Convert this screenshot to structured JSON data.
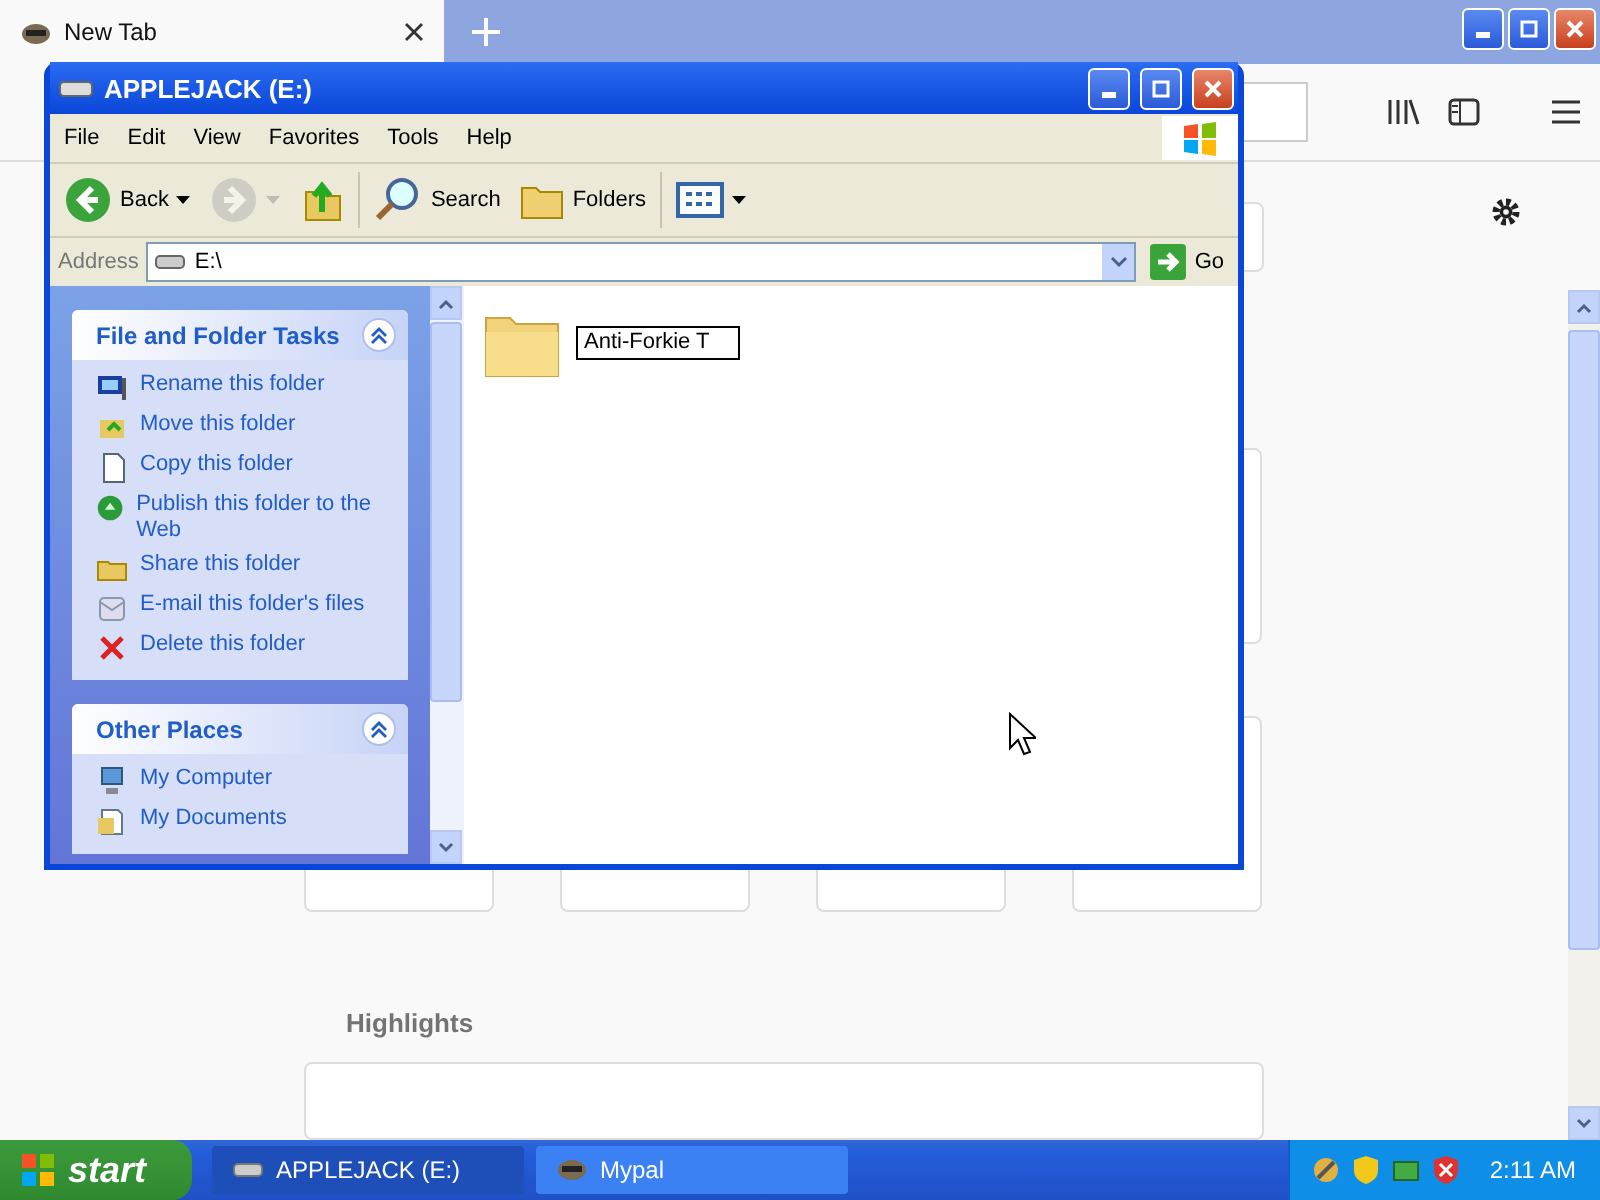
{
  "browser": {
    "tabs": [
      {
        "label": "New Tab",
        "selected": true
      }
    ],
    "section_title": "Highlights"
  },
  "explorer": {
    "title": "APPLEJACK (E:)",
    "menu": [
      "File",
      "Edit",
      "View",
      "Favorites",
      "Tools",
      "Help"
    ],
    "toolbar": {
      "back": "Back",
      "search": "Search",
      "folders": "Folders",
      "forward_disabled": true
    },
    "address": {
      "label": "Address",
      "value": "E:\\",
      "go": "Go"
    },
    "panels": [
      {
        "title": "File and Folder Tasks",
        "expanded": true,
        "items": [
          "Rename this folder",
          "Move this folder",
          "Copy this folder",
          "Publish this folder to the Web",
          "Share this folder",
          "E-mail this folder's files",
          "Delete this folder"
        ]
      },
      {
        "title": "Other Places",
        "expanded": true,
        "items": [
          "My Computer",
          "My Documents"
        ]
      }
    ],
    "files": [
      {
        "name": "Anti-Forkie T",
        "renaming": true
      }
    ]
  },
  "taskbar": {
    "start": "start",
    "tasks": [
      {
        "label": "APPLEJACK (E:)",
        "selected": true
      },
      {
        "label": "Mypal",
        "selected": false
      }
    ],
    "clock": "2:11 AM"
  }
}
